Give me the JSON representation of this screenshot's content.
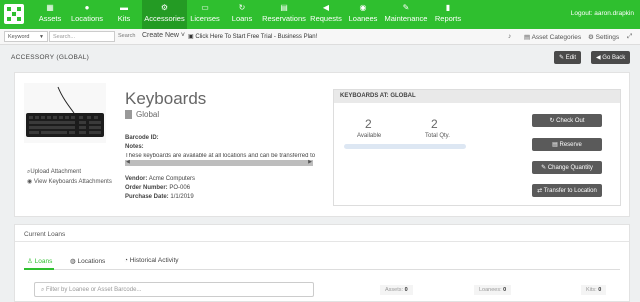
{
  "nav": {
    "items": [
      {
        "label": "Assets",
        "icon": "grid-icon"
      },
      {
        "label": "Locations",
        "icon": "pin-icon"
      },
      {
        "label": "Kits",
        "icon": "briefcase-icon"
      },
      {
        "label": "Accessories",
        "icon": "accessories-icon"
      },
      {
        "label": "Licenses",
        "icon": "license-icon"
      },
      {
        "label": "Loans",
        "icon": "refresh-icon"
      },
      {
        "label": "Reservations",
        "icon": "calendar-icon"
      },
      {
        "label": "Requests",
        "icon": "megaphone-icon"
      },
      {
        "label": "Loanees",
        "icon": "users-icon"
      },
      {
        "label": "Maintenance",
        "icon": "wrench-icon"
      },
      {
        "label": "Reports",
        "icon": "chart-icon"
      }
    ],
    "active": "Accessories",
    "logout": "Logout: aaron.drapkin"
  },
  "subbar": {
    "search_type": "Keyword",
    "search_placeholder": "Search...",
    "search_button": "Search",
    "create_new": "Create New",
    "trial_link": "Click Here To Start Free Trial - Business Plan!",
    "asset_categories": "Asset Categories",
    "settings": "Settings"
  },
  "header": {
    "title": "ACCESSORY  (GLOBAL)",
    "edit": "Edit",
    "go_back": "Go Back"
  },
  "accessory": {
    "name": "Keyboards",
    "site": "Global",
    "barcode_label": "Barcode ID:",
    "notes_label": "Notes:",
    "notes_text": "These keyboards are available at all locations and can be transferred to -",
    "vendor_label": "Vendor:",
    "vendor": "Acme Computers",
    "order_label": "Order Number:",
    "order": "PO-006",
    "purchase_label": "Purchase Date:",
    "purchase": "1/1/2019",
    "upload": "Upload Attachment",
    "view_attachments": "View Keyboards Attachments"
  },
  "panel": {
    "title": "KEYBOARDS AT: GLOBAL",
    "available_num": "2",
    "available_label": "Available",
    "total_num": "2",
    "total_label": "Total Qty.",
    "actions": [
      "Check Out",
      "Reserve",
      "Change Quantity",
      "Transfer to Location"
    ]
  },
  "loans": {
    "title": "Current Loans",
    "tabs": [
      "Loans",
      "Locations",
      "Historical Activity"
    ],
    "filter_placeholder": "Filter by Loanee or Asset Barcode...",
    "counts": [
      {
        "label": "Assets:",
        "value": "0"
      },
      {
        "label": "Loanees:",
        "value": "0"
      },
      {
        "label": "Kits:",
        "value": "0"
      }
    ]
  }
}
